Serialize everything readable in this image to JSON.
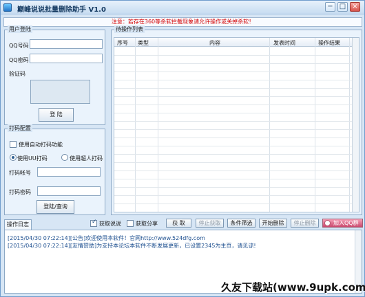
{
  "window": {
    "title": "巅峰说说批量删除助手 V1.0",
    "buttons": {
      "minimize": "−",
      "maximize": "□",
      "close": "×"
    }
  },
  "notice": "注意：若存在360等杀软拦截现象请允许操作或关掉杀软！",
  "login_group": {
    "title": "用户登陆",
    "qq_number_label": "QQ号码",
    "qq_password_label": "QQ密码",
    "captcha_label": "验证码",
    "login_button": "登 陆"
  },
  "captcha_group": {
    "title": "打码配置",
    "auto_captcha_label": "使用自动打码功能",
    "uu_radio_label": "使用UU打码",
    "super_radio_label": "使用超人打码",
    "account_label": "打码帐号",
    "password_label": "打码密码",
    "login_query_button": "登陆/查询"
  },
  "operations": {
    "title": "待操作列表",
    "columns": [
      "序号",
      "类型",
      "内容",
      "发表时间",
      "操作结果"
    ]
  },
  "toolbar": {
    "fetch_shuoshuo_label": "获取说说",
    "fetch_share_label": "获取分享",
    "fetch_button": "获 取",
    "stop_fetch_button": "停止获取",
    "filter_button": "条件筛选",
    "start_delete_button": "开始删除",
    "stop_delete_button": "停止删除",
    "join_qq_group_button": "加入QQ群"
  },
  "log": {
    "tab_label": "操作日志",
    "lines": [
      "[2015/04/30 07:22:14][公告]欢迎使用本软件！官网http://www.524dfg.com",
      "[2015/04/30 07:22:14][友情赞助]为支持本论坛本软件不断发展更新，已设置2345为主页，请见谅!"
    ]
  },
  "watermark": "久友下载站(www.9upk.com)"
}
